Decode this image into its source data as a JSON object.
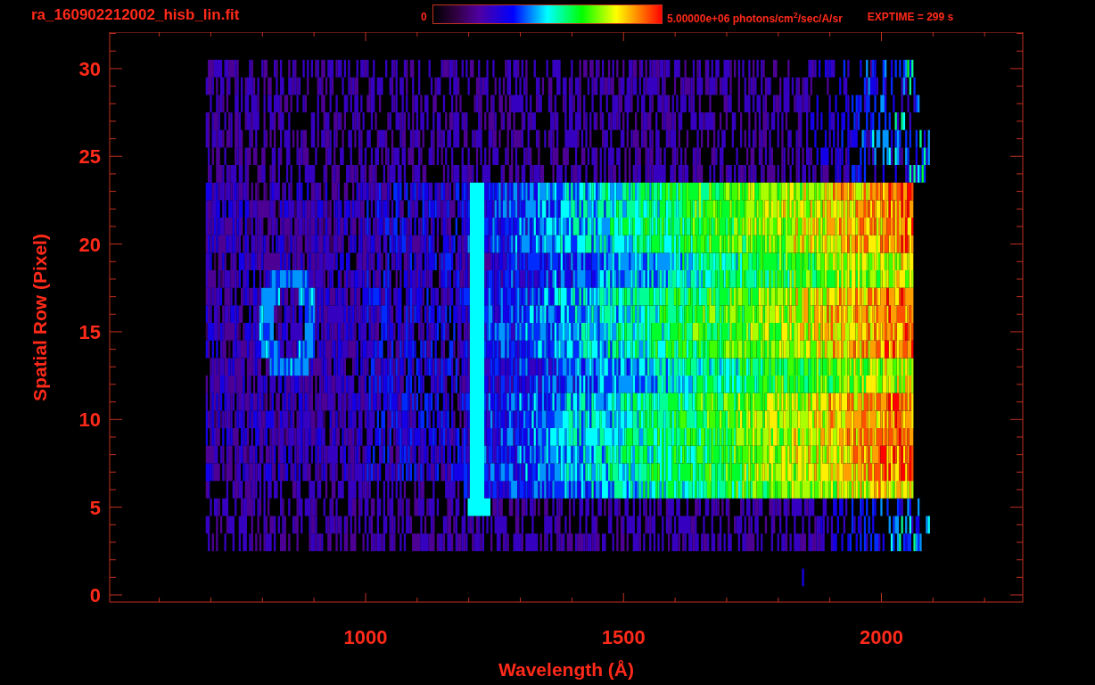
{
  "title": "ra_160902212002_hisb_lin.fit",
  "colorbar": {
    "min_label": "0",
    "max_label": "5.00000e+06 photons/cm$^{2}$/sec/A/sr"
  },
  "exposure": "EXPTIME = 299 s",
  "plot": {
    "xlabel": "Wavelength (Å)",
    "ylabel": "Spatial Row (Pixel)",
    "xtick_labels": [
      "1000",
      "1500",
      "2000"
    ],
    "ytick_labels": [
      "30",
      "25",
      "20",
      "15",
      "10",
      "5",
      "0"
    ]
  }
}
